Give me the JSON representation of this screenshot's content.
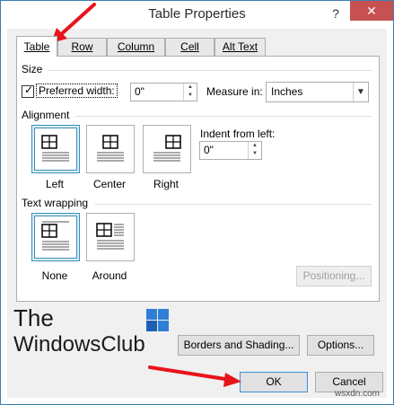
{
  "window": {
    "title": "Table Properties",
    "help_glyph": "?",
    "close_glyph": "✕"
  },
  "tabs": [
    {
      "label": "Table",
      "active": true
    },
    {
      "label": "Row",
      "active": false
    },
    {
      "label": "Column",
      "active": false
    },
    {
      "label": "Cell",
      "active": false
    },
    {
      "label": "Alt Text",
      "active": false
    }
  ],
  "size": {
    "section_label": "Size",
    "preferred_width_label": "Preferred width:",
    "preferred_width_checked": true,
    "preferred_width_value": "0\"",
    "measure_in_label": "Measure in:",
    "measure_in_value": "Inches"
  },
  "alignment": {
    "section_label": "Alignment",
    "options": [
      {
        "label": "Left",
        "selected": true,
        "icon": "table-align-left-icon"
      },
      {
        "label": "Center",
        "selected": false,
        "icon": "table-align-center-icon"
      },
      {
        "label": "Right",
        "selected": false,
        "icon": "table-align-right-icon"
      }
    ],
    "indent_label": "Indent from left:",
    "indent_value": "0\""
  },
  "text_wrapping": {
    "section_label": "Text wrapping",
    "options": [
      {
        "label": "None",
        "selected": true,
        "icon": "wrap-none-icon"
      },
      {
        "label": "Around",
        "selected": false,
        "icon": "wrap-around-icon"
      }
    ],
    "positioning_label": "Positioning..."
  },
  "buttons": {
    "borders_shading": "Borders and Shading...",
    "options": "Options...",
    "ok": "OK",
    "cancel": "Cancel"
  },
  "watermark": {
    "line1": "The",
    "line2": "WindowsClub",
    "corner": "wsxdn.com"
  },
  "colors": {
    "accent": "#3b8fb9",
    "close_button": "#c75050",
    "annotation_arrow": "#e8141b",
    "logo_blue": "#2f7fd6",
    "logo_dark_blue": "#1d5fb4"
  }
}
